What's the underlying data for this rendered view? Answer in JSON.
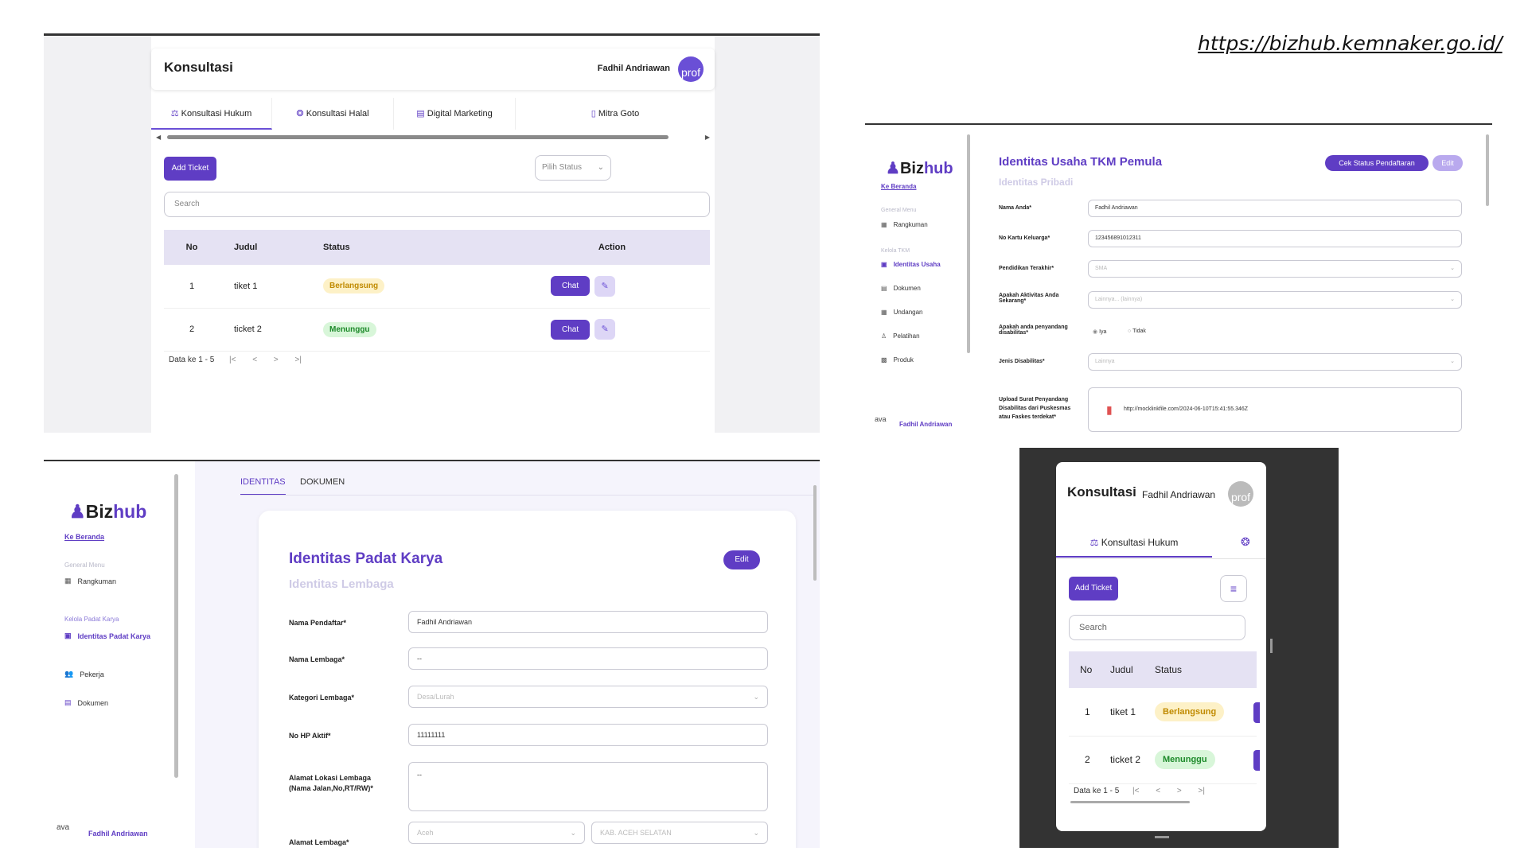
{
  "source_url": "https://bizhub.kemnaker.go.id/",
  "panel1": {
    "title": "Konsultasi",
    "user": "Fadhil Andriawan",
    "avatar": "prof",
    "tabs": [
      {
        "label": "Konsultasi Hukum",
        "icon": "scale-icon"
      },
      {
        "label": "Konsultasi Halal",
        "icon": "halal-icon"
      },
      {
        "label": "Digital Marketing",
        "icon": "store-icon"
      },
      {
        "label": "Mitra Goto",
        "icon": "phone-icon"
      }
    ],
    "add_ticket": "Add Ticket",
    "status_placeholder": "Pilih Status",
    "search_placeholder": "Search",
    "columns": [
      "No",
      "Judul",
      "Status",
      "Action"
    ],
    "rows": [
      {
        "no": "1",
        "judul": "tiket 1",
        "status": "Berlangsung"
      },
      {
        "no": "2",
        "judul": "ticket 2",
        "status": "Menunggu"
      }
    ],
    "chat_label": "Chat",
    "pagination": "Data ke 1 - 5",
    "pager": [
      "|<",
      "<",
      ">",
      ">|"
    ]
  },
  "panel2": {
    "logo_main": "Biz",
    "logo_accent": "hub",
    "ke_beranda": "Ke Beranda",
    "menu_label": "General Menu",
    "menu_items": [
      "Rangkuman"
    ],
    "kelola_label": "Kelola TKM",
    "kelola_items": [
      "Identitas Usaha",
      "Dokumen",
      "Undangan",
      "Pelatihan",
      "Produk"
    ],
    "user": "Fadhil Andriawan",
    "avatar_alt": "ava",
    "title": "Identitas Usaha TKM Pemula",
    "subtitle": "Identitas Pribadi",
    "cek_status": "Cek Status Pendaftaran",
    "edit": "Edit",
    "fields": [
      {
        "label": "Nama Anda*",
        "value": "Fadhil Andriawan"
      },
      {
        "label": "No Kartu Keluarga*",
        "value": "123456891012311"
      },
      {
        "label": "Pendidikan Terakhir*",
        "value": "SMA"
      },
      {
        "label": "Apakah Aktivitas Anda Sekarang*",
        "value": "Lainnya... (lainnya)"
      },
      {
        "label": "Apakah anda penyandang disabilitas*",
        "value": ""
      },
      {
        "label": "Jenis Disabilitas*",
        "value": "Lainnya"
      },
      {
        "label": "Upload Surat Penyandang Disabilitas dari Puskesmas atau Faskes terdekat*",
        "value": "http://mocklinkfile.com/2024-06-10T15:41:55.346Z"
      }
    ],
    "radio_yes": "Iya",
    "radio_no": "Tidak"
  },
  "panel3": {
    "logo_main": "Biz",
    "logo_accent": "hub",
    "ke_beranda": "Ke Beranda",
    "menu_label": "General Menu",
    "menu_item": "Rangkuman",
    "kelola_label": "Kelola Padat Karya",
    "kelola_items": [
      "Identitas Padat Karya",
      "Pekerja",
      "Dokumen"
    ],
    "user": "Fadhil Andriawan",
    "avatar_alt": "ava",
    "tabs": [
      "IDENTITAS",
      "DOKUMEN"
    ],
    "title": "Identitas Padat Karya",
    "subtitle": "Identitas Lembaga",
    "edit": "Edit",
    "fields": [
      {
        "label": "Nama Pendaftar*",
        "value": "Fadhil Andriawan"
      },
      {
        "label": "Nama Lembaga*",
        "value": "--"
      },
      {
        "label": "Kategori Lembaga*",
        "value": "Desa/Lurah"
      },
      {
        "label": "No HP Aktif*",
        "value": "11111111"
      },
      {
        "label": "Alamat Lokasi Lembaga (Nama Jalan,No,RT/RW)*",
        "value": "--"
      },
      {
        "label": "Alamat Lembaga*",
        "value": "Aceh"
      }
    ],
    "kabupaten": "KAB. ACEH SELATAN"
  },
  "panel4": {
    "title": "Konsultasi",
    "user": "Fadhil Andriawan",
    "avatar": "prof",
    "tab": "Konsultasi Hukum",
    "add_ticket": "Add Ticket",
    "search_placeholder": "Search",
    "columns": [
      "No",
      "Judul",
      "Status"
    ],
    "rows": [
      {
        "no": "1",
        "judul": "tiket 1",
        "status": "Berlangsung"
      },
      {
        "no": "2",
        "judul": "ticket 2",
        "status": "Menunggu"
      }
    ],
    "pagination": "Data ke 1 - 5",
    "pager": [
      "|<",
      "<",
      ">",
      ">|"
    ]
  },
  "colors": {
    "accent": "#5f3dc4",
    "badge_yellow": "#fdf1c7",
    "badge_green": "#d8f6d9"
  }
}
